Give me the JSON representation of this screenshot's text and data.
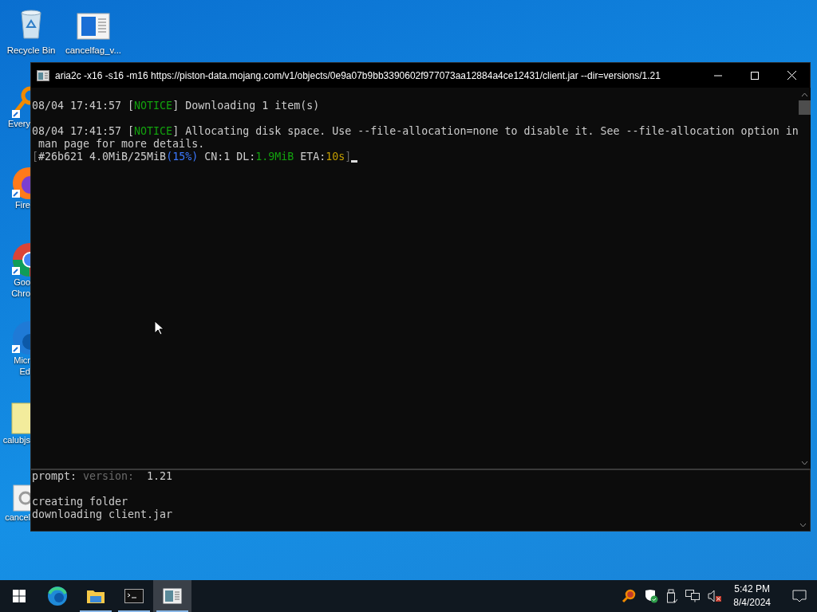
{
  "desktop_icons": [
    {
      "labels": [
        "Recycle Bin"
      ],
      "kind": "recycle-bin"
    },
    {
      "labels": [
        "cancelfag_v..."
      ],
      "kind": "document"
    }
  ],
  "side_icons": [
    {
      "labels": [
        "Every"
      ],
      "kind": "everything"
    },
    {
      "labels": [
        "Fire"
      ],
      "kind": "firefox"
    },
    {
      "labels": [
        "Goo",
        "Chro"
      ],
      "kind": "chrome"
    },
    {
      "labels": [
        "Micr",
        "Ed"
      ],
      "kind": "edge"
    },
    {
      "labels": [
        "calubjs"
      ],
      "kind": "text-file"
    },
    {
      "labels": [
        "cancel"
      ],
      "kind": "settings-file"
    }
  ],
  "window": {
    "title": "aria2c  -x16 -s16 -m16 https://piston-data.mojang.com/v1/objects/0e9a07b9bb3390602f977073aa12884a4ce12431/client.jar --dir=versions/1.21"
  },
  "top_lines": [
    {
      "blank_before": false,
      "cursor": false,
      "segments": [
        {
          "text": "08/04 17:41:57 [",
          "kind": "plain"
        },
        {
          "text": "NOTICE",
          "kind": "green"
        },
        {
          "text": "] Downloading 1 item(s)",
          "kind": "plain"
        }
      ]
    },
    {
      "blank_before": true,
      "cursor": false,
      "segments": [
        {
          "text": "08/04 17:41:57 [",
          "kind": "plain"
        },
        {
          "text": "NOTICE",
          "kind": "green"
        },
        {
          "text": "] Allocating disk space. Use --file-allocation=none to disable it. See --file-allocation option in",
          "kind": "plain"
        }
      ]
    },
    {
      "blank_before": false,
      "cursor": false,
      "segments": [
        {
          "text": " man page for more details.",
          "kind": "plain"
        }
      ]
    },
    {
      "blank_before": false,
      "cursor": true,
      "segments": [
        {
          "text": "[",
          "kind": "dim"
        },
        {
          "text": "#26b621 4.0MiB/25MiB",
          "kind": "plain"
        },
        {
          "text": "(15%)",
          "kind": "blue"
        },
        {
          "text": " CN:1 DL:",
          "kind": "plain"
        },
        {
          "text": "1.9MiB",
          "kind": "green"
        },
        {
          "text": " ETA:",
          "kind": "plain"
        },
        {
          "text": "10s",
          "kind": "yellow"
        },
        {
          "text": "]",
          "kind": "dim"
        }
      ]
    }
  ],
  "bottom_lines": [
    {
      "blank_before": false,
      "cursor": false,
      "segments": [
        {
          "text": "prompt: ",
          "kind": "plain"
        },
        {
          "text": "version:",
          "kind": "dim"
        },
        {
          "text": "  1.21",
          "kind": "plain"
        }
      ]
    },
    {
      "blank_before": true,
      "cursor": false,
      "segments": [
        {
          "text": "creating folder",
          "kind": "plain"
        }
      ]
    },
    {
      "blank_before": false,
      "cursor": false,
      "segments": [
        {
          "text": "downloading client.jar",
          "kind": "plain"
        }
      ]
    }
  ],
  "taskbar": {
    "apps": [
      {
        "kind": "edge",
        "running": false,
        "selected": false
      },
      {
        "kind": "explorer",
        "running": true,
        "selected": false
      },
      {
        "kind": "terminal",
        "running": true,
        "selected": false
      },
      {
        "kind": "document",
        "running": true,
        "selected": true
      }
    ],
    "time": "5:42 PM",
    "date": "8/4/2024"
  }
}
